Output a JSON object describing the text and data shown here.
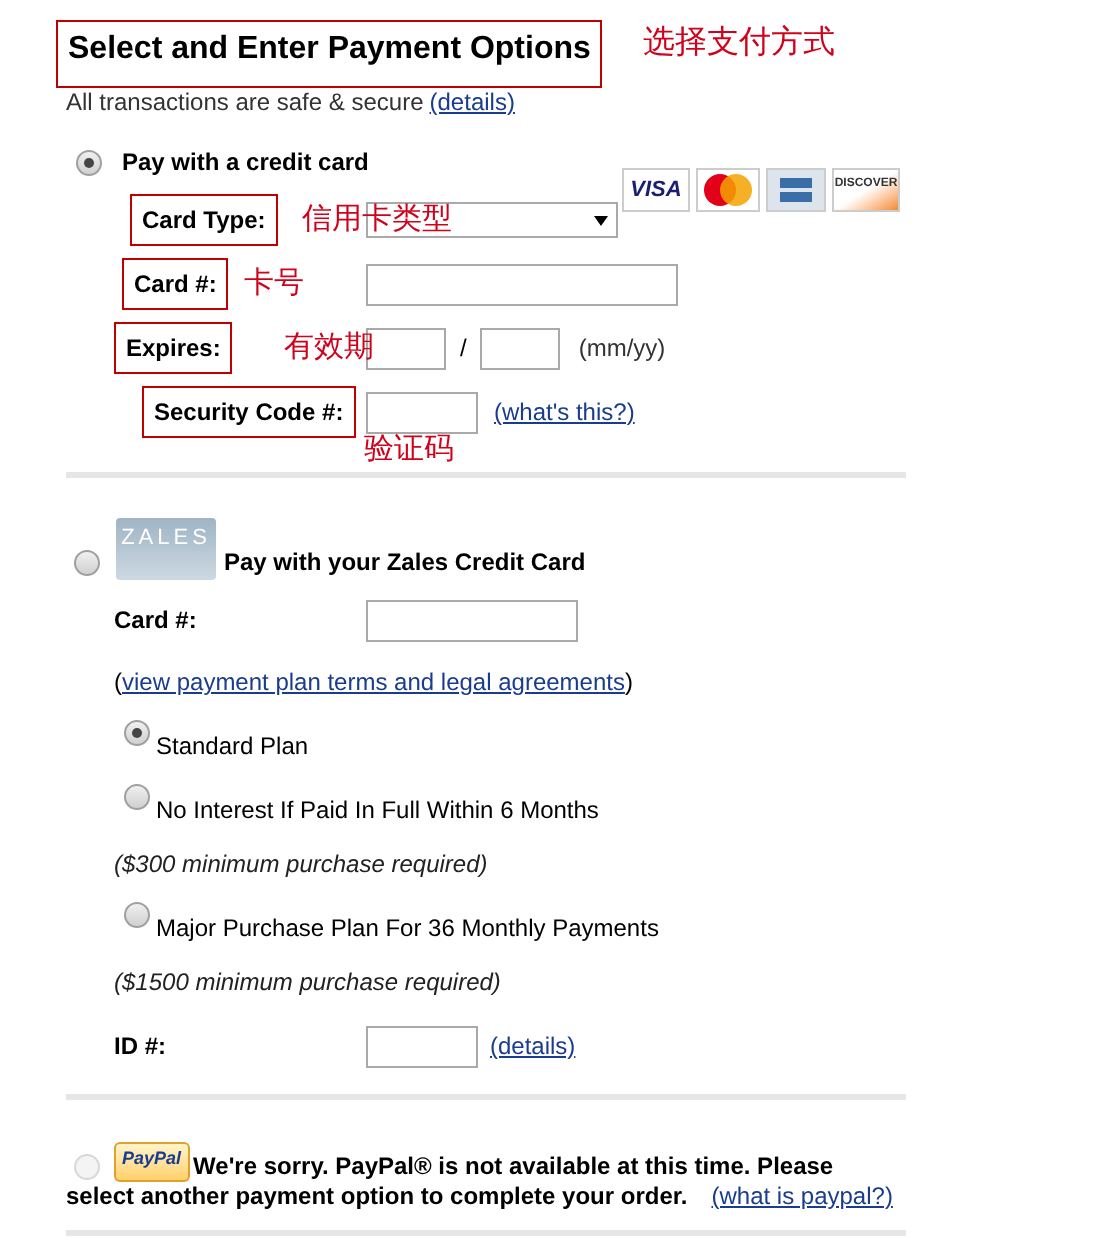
{
  "header": {
    "title": "Select and Enter Payment Options",
    "note": "选择支付方式",
    "subtitle": "All transactions are safe & secure",
    "link": "(details)"
  },
  "credit_card": {
    "selected": true,
    "label": "Pay with a credit card",
    "logos": [
      {
        "kind": "visa",
        "text": "VISA"
      },
      {
        "kind": "mastercard"
      },
      {
        "kind": "amex"
      },
      {
        "kind": "discover",
        "text": "DISCOVER"
      }
    ],
    "fields": [
      {
        "kind": "select",
        "label": "Card Type:",
        "note": "信用卡类型"
      },
      {
        "kind": "text",
        "label": "Card #:",
        "note": "卡号"
      },
      {
        "kind": "expiry",
        "label": "Expires:",
        "note": "有效期",
        "separator": "/",
        "hint": "(mm/yy)"
      },
      {
        "kind": "code",
        "label": "Security Code #:",
        "note": "验证码",
        "link": "(what's this?)"
      }
    ]
  },
  "zales": {
    "selected": false,
    "card_text": "ZALES",
    "label": "Pay with your Zales Credit Card",
    "card_label": "Card #:",
    "terms_prefix": "(",
    "terms_link": "view payment plan terms and legal agreements",
    "terms_suffix": ")",
    "plans": [
      {
        "label": "Standard Plan",
        "selected": true
      },
      {
        "label": "No Interest If Paid In Full Within 6 Months",
        "selected": false,
        "note": "($300 minimum purchase required)"
      },
      {
        "label": "Major Purchase Plan For 36 Monthly Payments",
        "selected": false,
        "note": "($1500 minimum purchase required)"
      }
    ],
    "id_label": "ID #:",
    "id_link": "(details)"
  },
  "paypal": {
    "selected": false,
    "disabled": true,
    "logo_text": "PayPal",
    "message_lines": [
      "We're sorry. PayPal® is not available at this time. Please",
      "select another payment option to complete your order."
    ],
    "link": "(what is paypal?)"
  }
}
